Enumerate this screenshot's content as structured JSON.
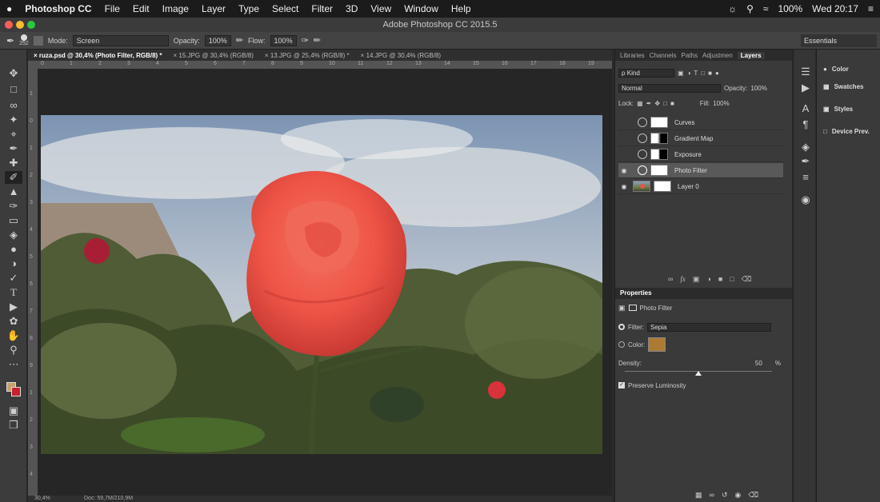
{
  "menubar": {
    "apple": "",
    "app": "Photoshop CC",
    "items": [
      "File",
      "Edit",
      "Image",
      "Layer",
      "Type",
      "Select",
      "Filter",
      "3D",
      "View",
      "Window",
      "Help"
    ],
    "battery": "100%",
    "clock": "Wed 20:17"
  },
  "window": {
    "title": "Adobe Photoshop CC 2015.5"
  },
  "options": {
    "brush_size": "252",
    "mode_label": "Mode:",
    "mode_value": "Screen",
    "opacity_label": "Opacity:",
    "opacity_value": "100%",
    "flow_label": "Flow:",
    "flow_value": "100%",
    "workspace": "Essentials"
  },
  "tabs": [
    {
      "label": "ruza.psd @ 30,4% (Photo Filter, RGB/8) *"
    },
    {
      "label": "15.JPG @ 30,4% (RGB/8)"
    },
    {
      "label": "13.JPG @ 25,4% (RGB/8) *"
    },
    {
      "label": "14.JPG @ 30,4% (RGB/8)"
    }
  ],
  "ruler": {
    "h": [
      "0",
      "1",
      "2",
      "3",
      "4",
      "5",
      "6",
      "7",
      "8",
      "9",
      "10",
      "11",
      "12",
      "13",
      "14",
      "15",
      "16",
      "17",
      "18",
      "19"
    ],
    "v": [
      "1",
      "0",
      "1",
      "2",
      "3",
      "4",
      "5",
      "6",
      "7",
      "8",
      "9",
      "1",
      "2",
      "3",
      "4"
    ]
  },
  "status": {
    "zoom": "30,4%",
    "doc": "Doc: 59,7M/210,9M"
  },
  "layers_panel": {
    "tabs": [
      "Libraries",
      "Channels",
      "Paths",
      "Adjustmen",
      "Layers"
    ],
    "kind_label": "ρ Kind",
    "blend": "Normal",
    "opacity_label": "Opacity:",
    "opacity": "100%",
    "lock_label": "Lock:",
    "fill_label": "Fill:",
    "fill": "100%",
    "layers": [
      {
        "name": "Curves",
        "visible": false,
        "selected": false
      },
      {
        "name": "Gradient Map",
        "visible": false,
        "selected": false
      },
      {
        "name": "Exposure",
        "visible": false,
        "selected": false
      },
      {
        "name": "Photo Filter",
        "visible": true,
        "selected": true
      },
      {
        "name": "Layer 0",
        "visible": true,
        "selected": false
      }
    ]
  },
  "properties": {
    "title": "Properties",
    "adj_name": "Photo Filter",
    "filter_label": "Filter:",
    "filter_value": "Sepia",
    "color_label": "Color:",
    "color_hex": "#ac7a33",
    "density_label": "Density:",
    "density_value": "50",
    "density_unit": "%",
    "density_fraction": 0.5,
    "preserve_label": "Preserve Luminosity"
  },
  "mini_panels": [
    {
      "label": "Color",
      "icon": "color-icon"
    },
    {
      "label": "Swatches",
      "icon": "swatches-icon"
    },
    {
      "label": "Styles",
      "icon": "styles-icon"
    },
    {
      "label": "Device Prev.",
      "icon": "device-preview-icon"
    }
  ]
}
